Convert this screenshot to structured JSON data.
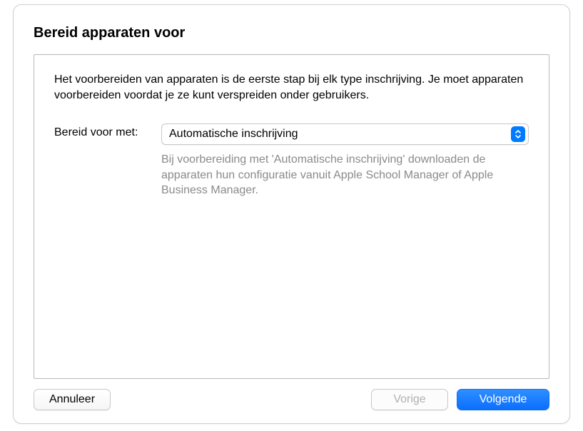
{
  "sheet": {
    "title": "Bereid apparaten voor",
    "intro": "Het voorbereiden van apparaten is de eerste stap bij elk type inschrijving. Je moet apparaten voorbereiden voordat je ze kunt verspreiden onder gebruikers.",
    "form": {
      "prepare_with_label": "Bereid voor met:",
      "prepare_with_value": "Automatische inschrijving",
      "prepare_with_hint": "Bij voorbereiding met 'Automatische inschrijving' downloaden de apparaten hun configuratie vanuit Apple School Manager of Apple Business Manager."
    },
    "buttons": {
      "cancel": "Annuleer",
      "previous": "Vorige",
      "next": "Volgende"
    }
  }
}
